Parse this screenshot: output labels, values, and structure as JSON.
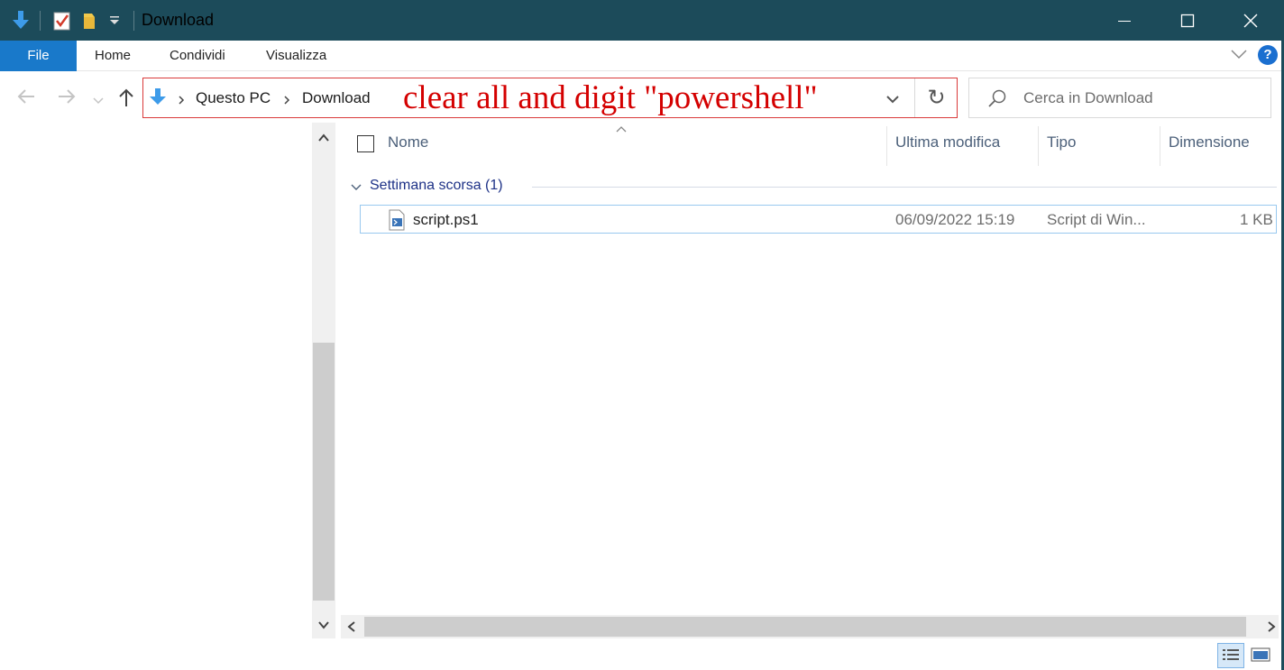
{
  "window": {
    "title": "Download",
    "accent_color": "#1c4b5a"
  },
  "ribbon": {
    "tabs": [
      "File",
      "Home",
      "Condividi",
      "Visualizza"
    ],
    "help_label": "?"
  },
  "address_bar": {
    "crumbs": [
      "Questo PC",
      "Download"
    ],
    "refresh_icon": "↻"
  },
  "annotation": {
    "text": "clear all and digit \"powershell\"",
    "color": "#d40000"
  },
  "search": {
    "placeholder": "Cerca in Download"
  },
  "columns": [
    "Nome",
    "Ultima modifica",
    "Tipo",
    "Dimensione"
  ],
  "group": {
    "label": "Settimana scorsa (1)"
  },
  "files": [
    {
      "name": "script.ps1",
      "modified": "06/09/2022 15:19",
      "type": "Script di Win...",
      "size": "1 KB",
      "icon": "powershell-script-icon"
    }
  ]
}
